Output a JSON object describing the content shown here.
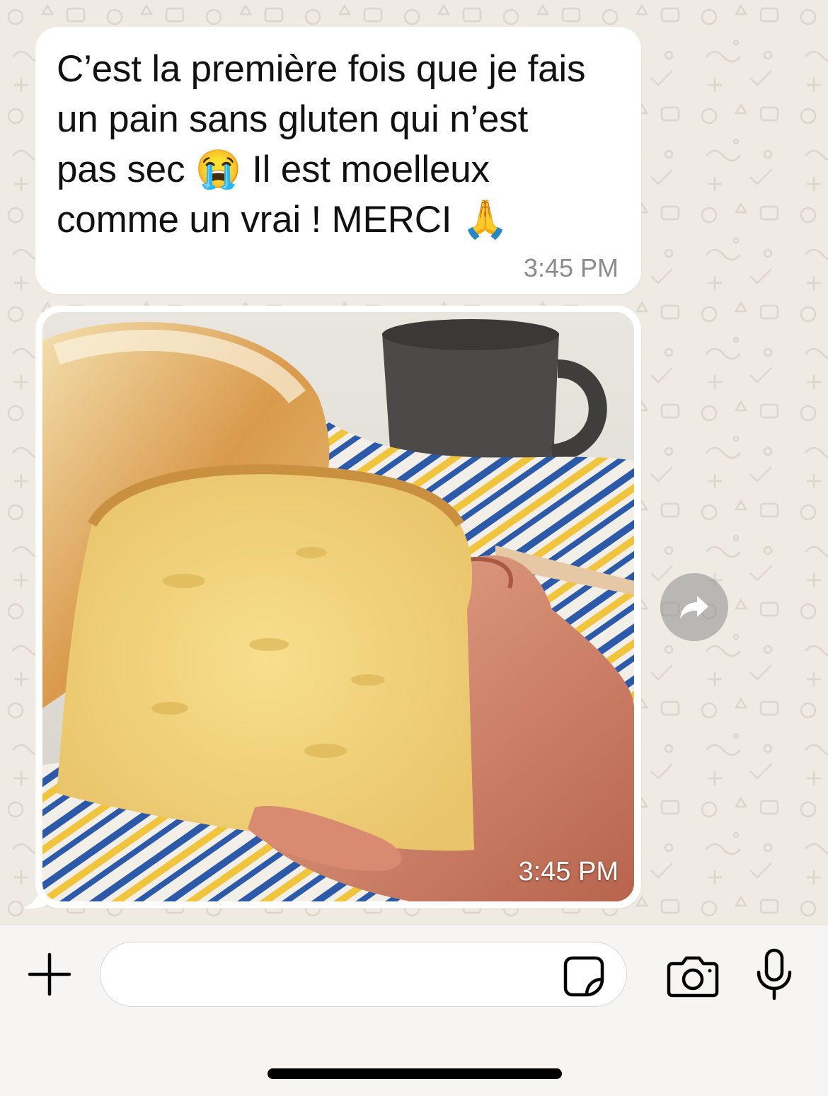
{
  "conversation": {
    "messages": [
      {
        "text_lines": [
          "C’est la première fois que je fais",
          "un pain sans gluten qui n’est",
          "pas sec 😭 Il est moelleux",
          "comme un vrai ! MERCI 🙏"
        ],
        "time": "3:45 PM"
      },
      {
        "image_caption": "",
        "time": "3:45 PM"
      }
    ]
  },
  "composer": {
    "value": "",
    "placeholder": ""
  },
  "icons": {
    "add": "plus-icon",
    "sticker": "sticker-icon",
    "camera": "camera-icon",
    "microphone": "microphone-icon",
    "forward": "forward-arrow-icon"
  },
  "colors": {
    "chat_background": "#efeae2",
    "bubble": "#ffffff",
    "timestamp": "#8c8c8c",
    "input_bar": "#f6f5f3"
  }
}
